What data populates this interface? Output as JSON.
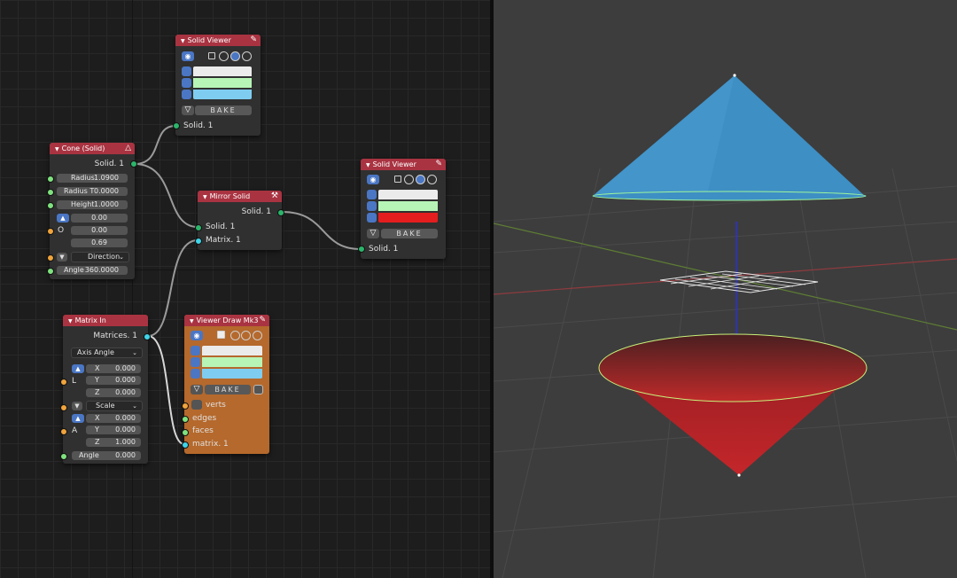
{
  "nodes": {
    "cone": {
      "title": "Cone (Solid)",
      "output": "Solid. 1",
      "radius_label": "Radius",
      "radius_value": "1.0900",
      "radius_t_label": "Radius T",
      "radius_t_value": "0.0000",
      "height_label": "Height",
      "height_value": "1.0000",
      "origin_label": "O",
      "origin_x": "0.00",
      "origin_y": "0.00",
      "origin_z": "0.69",
      "direction_label": "Direction",
      "angle_label": "Angle",
      "angle_value": "360.0000"
    },
    "solid_viewer_top": {
      "title": "Solid Viewer",
      "bake_label": "BAKE",
      "input": "Solid. 1"
    },
    "mirror_solid": {
      "title": "Mirror Solid",
      "output": "Solid. 1",
      "input_solid": "Solid. 1",
      "input_matrix": "Matrix. 1"
    },
    "solid_viewer_right": {
      "title": "Solid Viewer",
      "bake_label": "BAKE",
      "input": "Solid. 1"
    },
    "matrix_in": {
      "title": "Matrix In",
      "output": "Matrices. 1",
      "mode": "Axis Angle",
      "location_label": "L",
      "lx_label": "X",
      "lx": "0.000",
      "ly_label": "Y",
      "ly": "0.000",
      "lz_label": "Z",
      "lz": "0.000",
      "scale_label": "Scale",
      "axis_label": "A",
      "ax_label": "X",
      "ax": "0.000",
      "ay_label": "Y",
      "ay": "0.000",
      "az_label": "Z",
      "az": "1.000",
      "angle_label": "Angle",
      "angle_value": "0.000"
    },
    "viewer_draw": {
      "title": "Viewer Draw Mk3",
      "bake_label": "BAKE",
      "inputs": [
        "verts",
        "edges",
        "faces",
        "matrix. 1"
      ]
    }
  },
  "colors": {
    "node_header_red": "#a93341",
    "viewer_draw_body": "#b5692c",
    "swatch_white": "#ebebeb",
    "swatch_green": "#b6f5b6",
    "swatch_blue": "#7ecdf0",
    "swatch_red": "#e41e1e",
    "cone_top": "#3d8fc4",
    "cone_bottom": "#b3262c"
  },
  "icons": [
    "eye-icon",
    "pencil-icon",
    "cone-icon",
    "wrench-icon",
    "vertex-icon",
    "edge-icon",
    "face-icon",
    "shading-icons",
    "triangle-icon"
  ]
}
